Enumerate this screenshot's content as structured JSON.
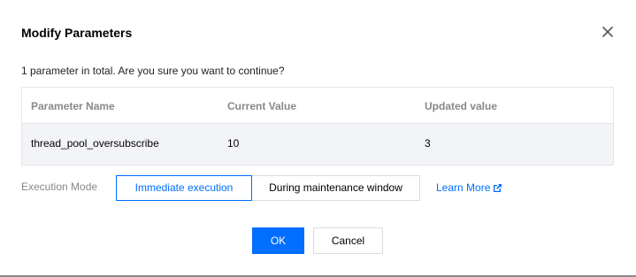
{
  "dialog": {
    "title": "Modify Parameters",
    "summary": "1 parameter in total. Are you sure you want to continue?"
  },
  "table": {
    "headers": [
      "Parameter Name",
      "Current Value",
      "Updated value"
    ],
    "rows": [
      [
        "thread_pool_oversubscribe",
        "10",
        "3"
      ]
    ]
  },
  "execution": {
    "label": "Execution Mode",
    "options": [
      "Immediate execution",
      "During maintenance window"
    ],
    "selected": "Immediate execution",
    "learn_more": "Learn More",
    "learn_more_icon": "external-link-icon"
  },
  "footer": {
    "ok_label": "OK",
    "cancel_label": "Cancel"
  },
  "colors": {
    "accent": "#006eff",
    "header_text": "#888888",
    "row_background": "#f3f4f7"
  }
}
